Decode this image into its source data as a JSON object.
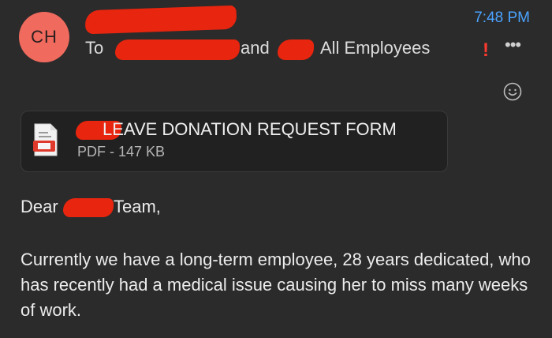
{
  "sender": {
    "initials": "CH"
  },
  "header": {
    "time": "7:48 PM",
    "to_label": "To",
    "and_label": "and",
    "recipient_group": "All Employees",
    "importance_mark": "!",
    "more_glyph": "•••"
  },
  "attachment": {
    "title": "LEAVE DONATION REQUEST FORM",
    "meta": "PDF - 147 KB",
    "icon": "pdf-file-icon"
  },
  "message": {
    "greeting_start": "Dear",
    "greeting_end": "Team,",
    "body": "Currently we have a long-term employee, 28 years dedicated, who has recently had a medical issue causing her to miss many weeks of work."
  },
  "colors": {
    "background": "#2b2b2b",
    "avatar": "#f06a5e",
    "time": "#4aa3ff",
    "importance": "#ff3b30",
    "redaction": "#e8250e"
  }
}
